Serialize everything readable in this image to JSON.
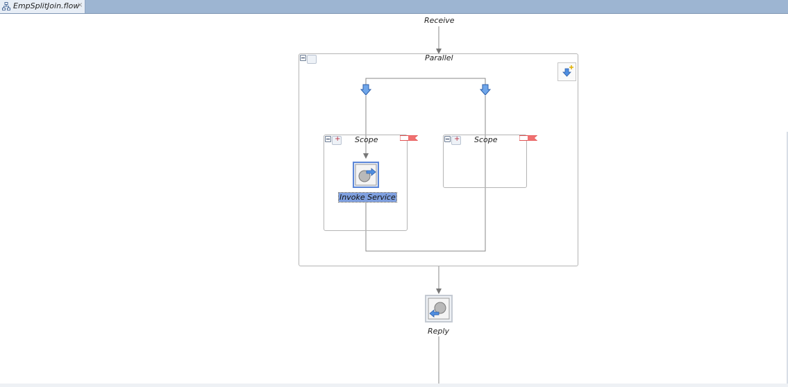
{
  "tab": {
    "title": "EmpSplitJoin.flow",
    "close": "×"
  },
  "flow": {
    "receive": "Receive",
    "parallel": "Parallel",
    "scope_left": "Scope",
    "scope_right": "Scope",
    "invoke": "Invoke Service",
    "reply": "Reply"
  },
  "colors": {
    "tabbar": "#9db5d2",
    "selection": "#7fa0e0",
    "branch_arrow": "#4f8ee0"
  }
}
